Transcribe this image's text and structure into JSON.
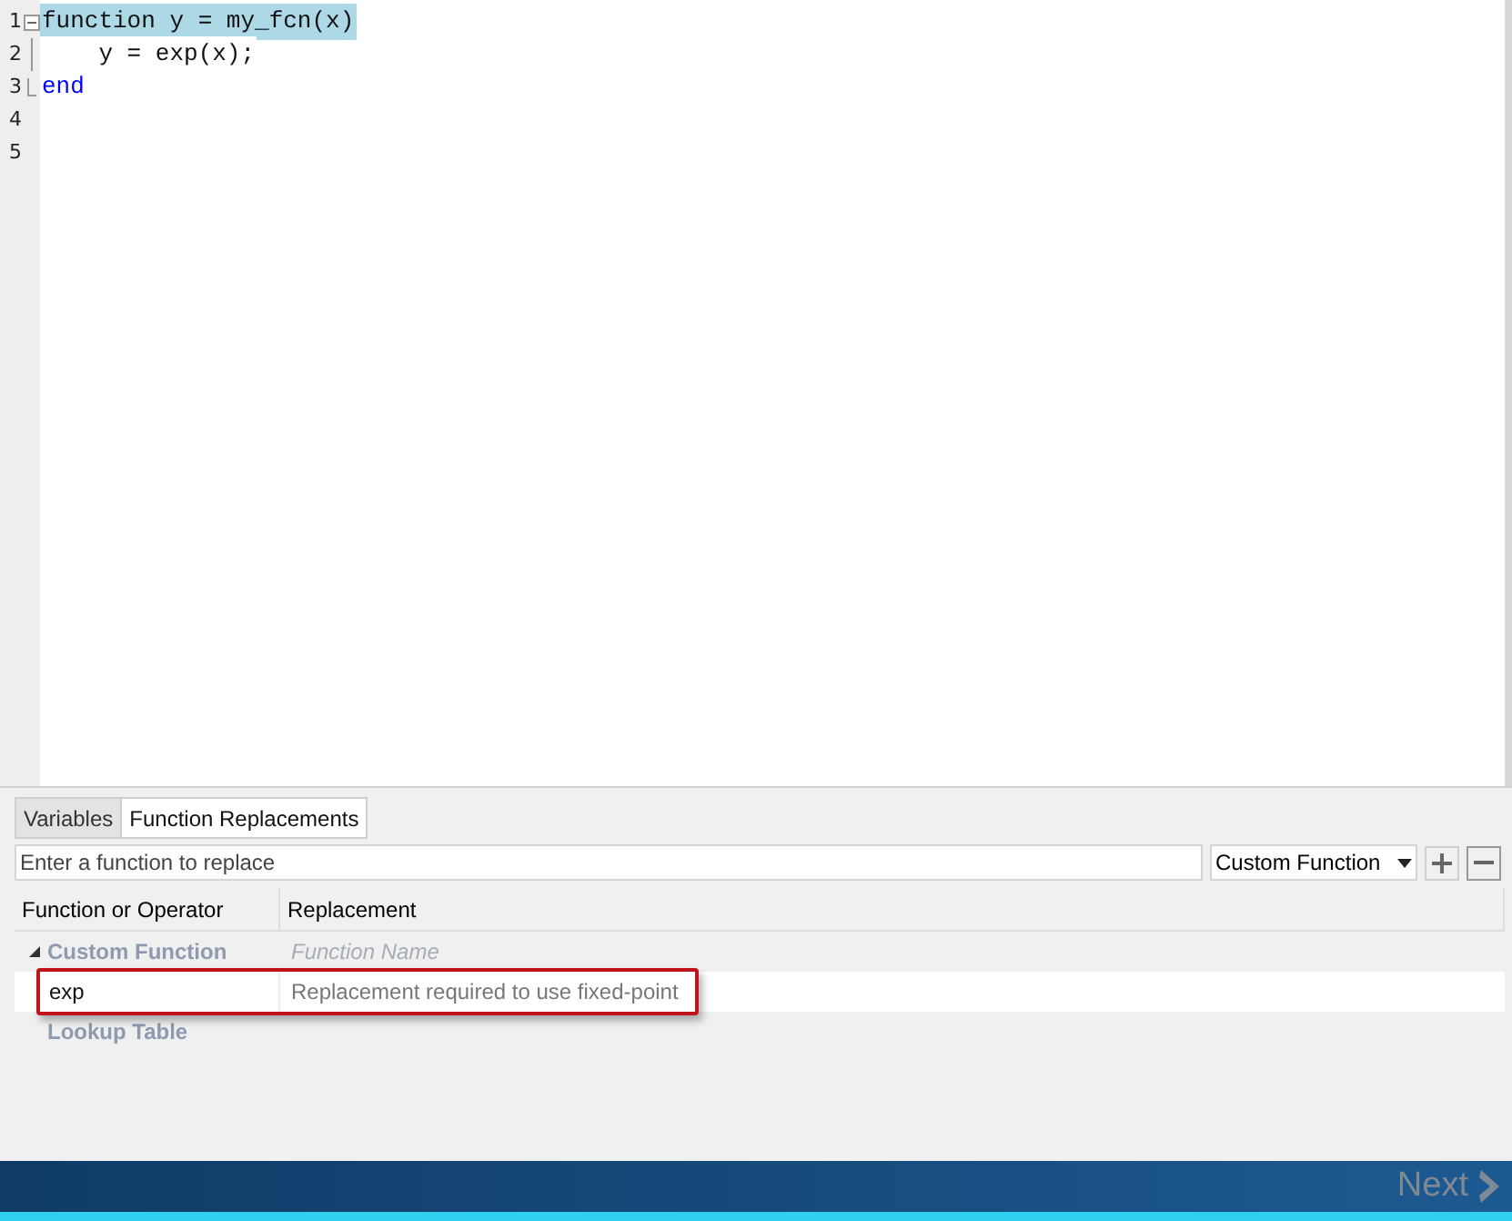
{
  "editor": {
    "lines": [
      {
        "number": "1",
        "kind": "fold_start",
        "highlighted": true,
        "tokens": [
          {
            "text": "function y = my_fcn(x)",
            "kind": "plain"
          }
        ]
      },
      {
        "number": "2",
        "kind": "fold_body",
        "highlighted": false,
        "tokens": [
          {
            "text": "    y = exp(x);",
            "kind": "plain"
          }
        ]
      },
      {
        "number": "3",
        "kind": "fold_end",
        "highlighted": false,
        "tokens": [
          {
            "text": "end",
            "kind": "keyword"
          }
        ]
      },
      {
        "number": "4",
        "kind": "plain"
      },
      {
        "number": "5",
        "kind": "plain"
      }
    ]
  },
  "tabs": [
    {
      "label": "Variables",
      "selected": false
    },
    {
      "label": "Function Replacements",
      "selected": true
    }
  ],
  "search": {
    "placeholder": "Enter a function to replace"
  },
  "type_dropdown": {
    "value": "Custom Function"
  },
  "table": {
    "columns": [
      "Function or Operator",
      "Replacement"
    ],
    "rows": [
      {
        "name": "Custom Function",
        "kind": "group",
        "expanded": true,
        "children": [
          {
            "name": "exp",
            "kind": "item",
            "replacement": "Replacement required to use fixed-point",
            "callout": true
          }
        ],
        "replacement_placeholder": "Function Name"
      },
      {
        "name": "Lookup Table",
        "kind": "group",
        "expanded": false,
        "children": []
      }
    ]
  },
  "footer": {
    "next_button": {
      "label": "Next",
      "disabled": true
    }
  }
}
